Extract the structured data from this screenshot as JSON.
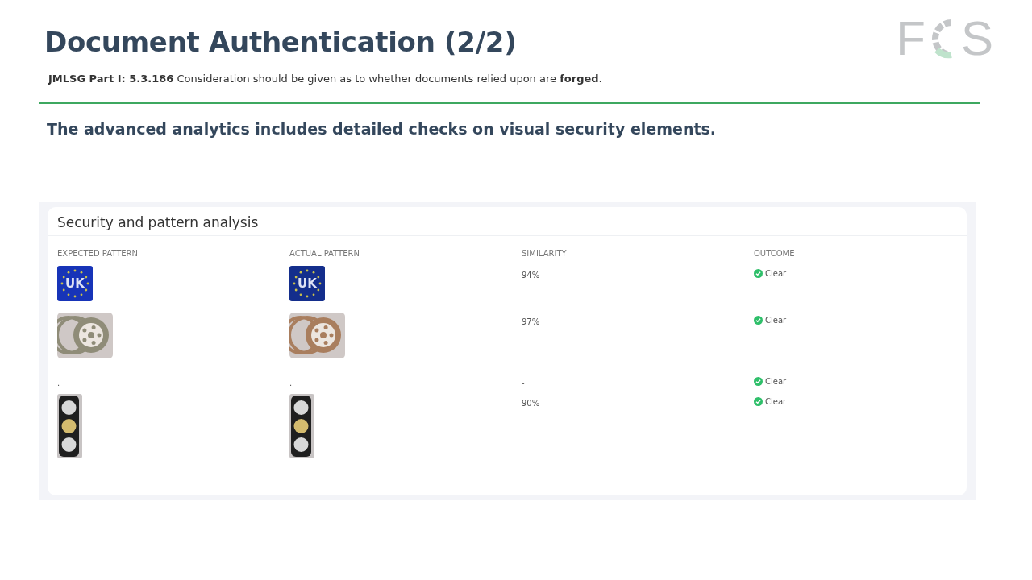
{
  "logo": {
    "letters": [
      "F",
      "S"
    ]
  },
  "title": "Document Authentication (2/2)",
  "reference": "**JMLSG Part I: 5.3.186** Consideration should be given as to whether documents relied upon are **forged**.",
  "heading": "The advanced analytics includes detailed checks on visual security elements.",
  "panel": {
    "title": "Security and pattern analysis",
    "columns": [
      "EXPECTED PATTERN",
      "ACTUAL PATTERN",
      "SIMILARITY",
      "OUTCOME"
    ],
    "rows": [
      {
        "expected": {
          "kind": "flag",
          "text": "UK"
        },
        "actual": {
          "kind": "flag",
          "text": "UK"
        },
        "similarity": "94%",
        "outcome": "Clear"
      },
      {
        "expected": {
          "kind": "wheel"
        },
        "actual": {
          "kind": "wheel"
        },
        "similarity": "97%",
        "outcome": "Clear"
      },
      {
        "expected": {
          "kind": "text",
          "text": "."
        },
        "actual": {
          "kind": "text",
          "text": "."
        },
        "similarity": "-",
        "outcome": "Clear"
      },
      {
        "expected": {
          "kind": "light"
        },
        "actual": {
          "kind": "light"
        },
        "similarity": "90%",
        "outcome": "Clear"
      }
    ]
  }
}
